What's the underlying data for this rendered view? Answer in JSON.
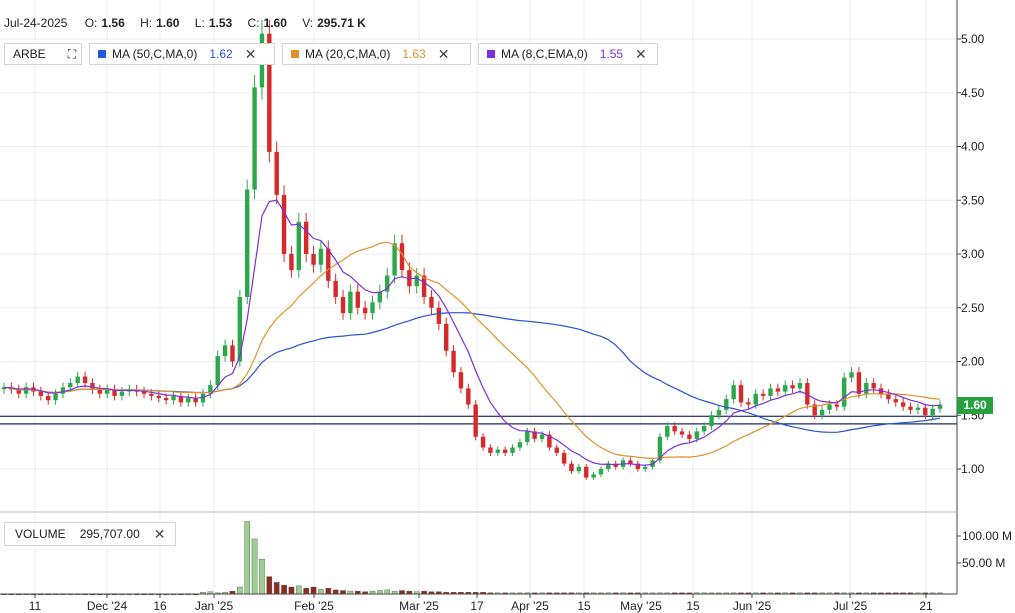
{
  "ohlc": {
    "date": "Jul-24-2025",
    "open_label": "O:",
    "open": "1.56",
    "high_label": "H:",
    "high": "1.60",
    "low_label": "L:",
    "low": "1.53",
    "close_label": "C:",
    "close": "1.60",
    "volume_label": "V:",
    "volume": "295.71 K"
  },
  "legend": {
    "symbol": "ARBE",
    "ma50": {
      "label": "MA (50,C,MA,0)",
      "value": "1.62",
      "color": "#2455d6"
    },
    "ma20": {
      "label": "MA (20,C,MA,0)",
      "value": "1.63",
      "color": "#e0922a"
    },
    "ema8": {
      "label": "MA (8,C,EMA,0)",
      "value": "1.55",
      "color": "#7b2fe0"
    },
    "close_icon": "close-x-icon",
    "expand_icon": "expand-icon"
  },
  "volume_legend": {
    "label": "VOLUME",
    "value": "295,707.00"
  },
  "price_tag": {
    "value": "1.60",
    "color": "#27a040"
  },
  "chart_data": {
    "type": "candlestick",
    "price_axis": {
      "ticks": [
        "5.00",
        "4.50",
        "4.00",
        "3.50",
        "3.00",
        "2.50",
        "2.00",
        "1.50",
        "1.00"
      ],
      "range": [
        0.72,
        5.3
      ]
    },
    "volume_axis": {
      "ticks": [
        "100.00 M",
        "50.00 M"
      ]
    },
    "x_tick_labels": [
      "11",
      "Dec '24",
      "16",
      "Jan '25",
      "Feb '25",
      "Mar '25",
      "17",
      "Apr '25",
      "15",
      "May '25",
      "15",
      "Jun '25",
      "Jul '25",
      "21"
    ],
    "support_lines": [
      1.49,
      1.42
    ],
    "colors": {
      "up": "#2ca84a",
      "down": "#d62a2a",
      "vol_up": "#9ccf8f",
      "vol_down": "#8b2b1f"
    },
    "closes": [
      1.76,
      1.74,
      1.7,
      1.76,
      1.72,
      1.68,
      1.64,
      1.7,
      1.76,
      1.8,
      1.86,
      1.8,
      1.74,
      1.7,
      1.74,
      1.68,
      1.72,
      1.74,
      1.72,
      1.7,
      1.68,
      1.66,
      1.64,
      1.68,
      1.62,
      1.66,
      1.62,
      1.7,
      1.78,
      2.05,
      2.15,
      2.0,
      2.6,
      3.6,
      4.55,
      5.05,
      3.95,
      3.55,
      3.0,
      2.85,
      3.3,
      3.0,
      2.9,
      3.05,
      2.75,
      2.6,
      2.45,
      2.65,
      2.5,
      2.45,
      2.55,
      2.65,
      2.8,
      3.1,
      2.85,
      2.7,
      2.8,
      2.6,
      2.5,
      2.35,
      2.1,
      1.9,
      1.75,
      1.6,
      1.3,
      1.2,
      1.15,
      1.18,
      1.15,
      1.2,
      1.25,
      1.35,
      1.28,
      1.32,
      1.2,
      1.15,
      1.05,
      0.98,
      1.02,
      0.92,
      0.95,
      1.0,
      1.05,
      1.02,
      1.08,
      1.05,
      1.0,
      1.02,
      1.08,
      1.3,
      1.4,
      1.35,
      1.32,
      1.28,
      1.35,
      1.4,
      1.5,
      1.55,
      1.65,
      1.78,
      1.62,
      1.6,
      1.7,
      1.68,
      1.75,
      1.72,
      1.78,
      1.75,
      1.8,
      1.6,
      1.5,
      1.55,
      1.6,
      1.58,
      1.85,
      1.9,
      1.7,
      1.8,
      1.75,
      1.7,
      1.65,
      1.62,
      1.58,
      1.55,
      1.57,
      1.5,
      1.56,
      1.6
    ],
    "volumes": [
      0.3,
      0.2,
      0.2,
      0.3,
      0.2,
      0.2,
      0.2,
      0.3,
      0.3,
      0.2,
      0.3,
      0.2,
      0.2,
      0.2,
      0.2,
      0.2,
      0.2,
      0.2,
      0.2,
      0.2,
      0.2,
      0.2,
      0.2,
      0.2,
      0.2,
      0.2,
      0.2,
      3,
      4,
      2,
      3,
      5,
      12,
      125,
      95,
      60,
      30,
      20,
      15,
      12,
      14,
      10,
      12,
      8,
      10,
      7,
      6,
      5,
      5,
      4,
      5,
      6,
      7,
      5,
      6,
      5,
      4,
      5,
      4,
      4,
      3,
      3,
      3,
      3,
      3,
      3,
      2,
      2,
      2,
      2,
      2,
      2,
      2,
      2,
      2,
      2,
      2,
      2,
      2,
      2,
      2,
      2,
      2,
      2,
      2,
      2,
      2,
      2,
      2,
      2,
      2,
      2,
      2,
      2,
      2,
      2,
      2,
      2,
      2,
      2,
      2,
      2,
      2,
      2,
      2,
      2,
      2,
      2,
      2,
      2,
      2,
      2,
      2,
      2,
      2,
      2,
      2,
      2,
      2,
      2,
      2,
      2,
      2,
      2,
      2,
      2,
      2,
      2
    ]
  }
}
